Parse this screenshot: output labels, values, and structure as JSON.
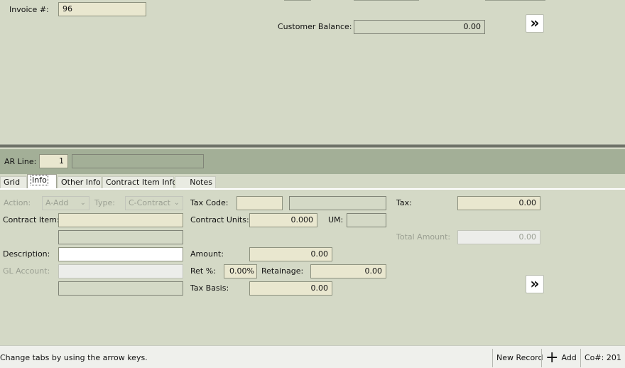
{
  "header": {
    "invoice_label": "Invoice #:",
    "invoice_value": "96",
    "customer_balance_label": "Customer Balance:",
    "customer_balance_value": "0.00",
    "next_icon": "double-chevron-right-icon"
  },
  "arline": {
    "label": "AR Line:",
    "value": "1",
    "description": ""
  },
  "tabs": [
    {
      "label": "Grid",
      "active": false
    },
    {
      "label": "Info",
      "active": true
    },
    {
      "label": "Other Info",
      "active": false
    },
    {
      "label": "Contract Item Info",
      "active": false
    },
    {
      "label": "Notes",
      "active": false
    }
  ],
  "form": {
    "action_label": "Action:",
    "action_value": "A-Add",
    "type_label": "Type:",
    "type_value": "C-Contract",
    "tax_code_label": "Tax Code:",
    "tax_code_value": "",
    "tax_code_desc": "",
    "tax_label": "Tax:",
    "tax_value": "0.00",
    "contract_item_label": "Contract Item:",
    "contract_item_value": "",
    "contract_item_desc": "",
    "contract_units_label": "Contract Units:",
    "contract_units_value": "0.000",
    "um_label": "UM:",
    "um_value": "",
    "total_amount_label": "Total Amount:",
    "total_amount_value": "0.00",
    "description_label": "Description:",
    "description_value": "",
    "amount_label": "Amount:",
    "amount_value": "0.00",
    "gl_account_label": "GL Account:",
    "gl_account_value": "",
    "gl_account_desc": "",
    "ret_pct_label": "Ret %:",
    "ret_pct_value": "0.00%",
    "retainage_label": "Retainage:",
    "retainage_value": "0.00",
    "tax_basis_label": "Tax Basis:",
    "tax_basis_value": "0.00"
  },
  "statusbar": {
    "message": "Change tabs by using the arrow keys.",
    "new_record": "New Record",
    "add_label": "Add",
    "add_icon": "plus-icon",
    "company": "Co#: 201"
  }
}
